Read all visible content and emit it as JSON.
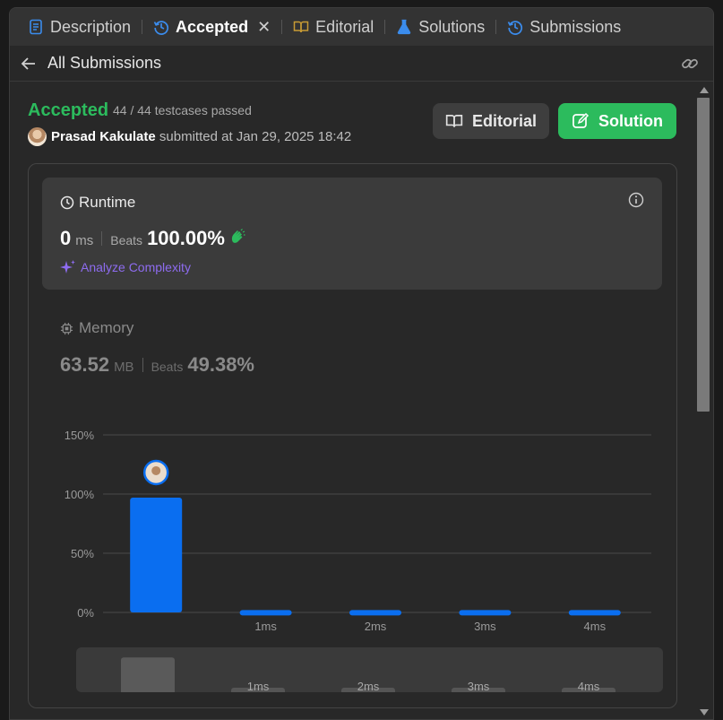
{
  "tabs": [
    {
      "label": "Description",
      "icon": "description-icon",
      "color": "#3b8ced"
    },
    {
      "label": "Accepted",
      "icon": "history-icon",
      "color": "#3b8ced",
      "active": true
    },
    {
      "label": "Editorial",
      "icon": "book-icon",
      "color": "#c89b34"
    },
    {
      "label": "Solutions",
      "icon": "flask-icon",
      "color": "#3b8ced"
    },
    {
      "label": "Submissions",
      "icon": "history-icon",
      "color": "#3b8ced"
    }
  ],
  "tab_close": "✕",
  "back": {
    "label": "All Submissions"
  },
  "result": {
    "status": "Accepted",
    "tests": "44 / 44 testcases passed",
    "author": "Prasad Kakulate",
    "submitted": "submitted at Jan 29, 2025 18:42"
  },
  "buttons": {
    "editorial": "Editorial",
    "solution": "Solution"
  },
  "runtime": {
    "title": "Runtime",
    "value": "0",
    "unit": "ms",
    "beats_label": "Beats",
    "beats": "100.00%",
    "analyze": "Analyze Complexity"
  },
  "memory": {
    "title": "Memory",
    "value": "63.52",
    "unit": "MB",
    "beats_label": "Beats",
    "beats": "49.38%"
  },
  "colors": {
    "accent_green": "#2cbb5d",
    "bar_blue": "#0a6ef0",
    "purple": "#8e6cf0"
  },
  "chart_data": {
    "type": "bar",
    "categories": [
      "",
      "1ms",
      "2ms",
      "3ms",
      "4ms"
    ],
    "values": [
      97,
      2,
      2,
      2,
      2
    ],
    "ylim": [
      0,
      150
    ],
    "yticks": [
      "150%",
      "100%",
      "50%",
      "0%"
    ],
    "ytick_values": [
      150,
      100,
      50,
      0
    ],
    "highlight_index": 0,
    "grid": true
  },
  "mini_chart": {
    "labels": [
      "1ms",
      "2ms",
      "3ms",
      "4ms"
    ]
  }
}
